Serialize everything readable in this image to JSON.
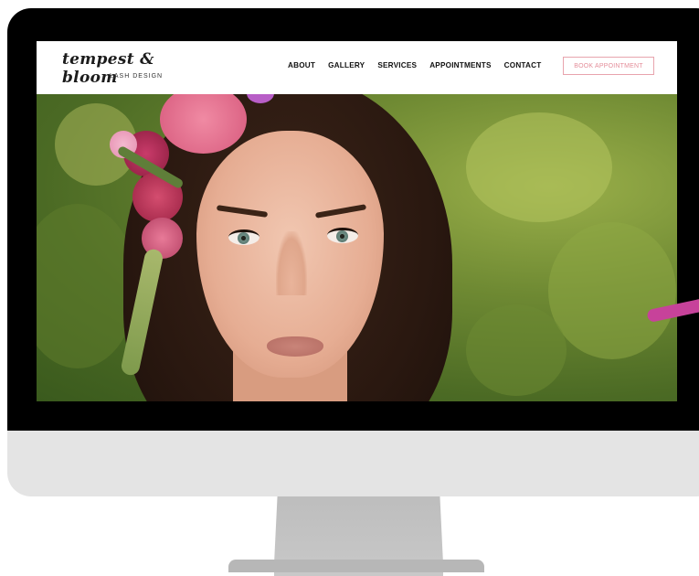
{
  "site": {
    "logo_text": "tempest & bloom",
    "logo_subtext": "LASH DESIGN",
    "nav": [
      "ABOUT",
      "GALLERY",
      "SERVICES",
      "APPOINTMENTS",
      "CONTACT"
    ],
    "cta_label": "BOOK APPOINTMENT"
  },
  "colors": {
    "accent": "#e48e9a",
    "bezel": "#000000",
    "chin": "#e4e4e4",
    "stand": "#bdbdbd",
    "pink_stroke": "#c7429a"
  }
}
